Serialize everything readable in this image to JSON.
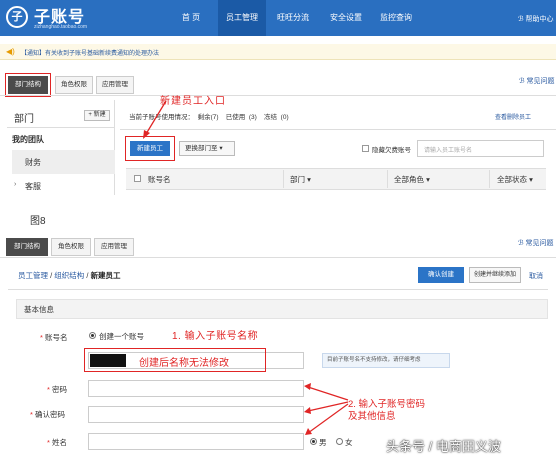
{
  "header": {
    "logo_glyph": "子",
    "title": "子账号",
    "subtitle": "zizhanghao.taobao.com",
    "nav": [
      "首 页",
      "员工管理",
      "旺旺分流",
      "安全设置",
      "监控查询"
    ],
    "right_link": "ℬ 帮助中心"
  },
  "notice": {
    "text": "【通知】有关收到子账号基础新续费通知的处理办法"
  },
  "tabs": [
    "部门结构",
    "角色权限",
    "应用管理"
  ],
  "help_link": "常见问题",
  "panel1": {
    "department_title": "部门",
    "new_button": "+ 新建",
    "team": "我的团队",
    "dept_items": [
      "财务",
      "客服"
    ],
    "usage_text": "当前子账号使用情况：  剩余(7)    已使用  (3)    冻结  (0)",
    "view_deleted": "查看删除员工",
    "new_employee_button": "新建员工",
    "change_dept_button": "更换部门至",
    "hide_expired": "隐藏欠费账号",
    "search_placeholder": "请输入员工账号名",
    "columns": [
      "账号名",
      "部门",
      "全部角色",
      "全部状态"
    ],
    "annotation": "新建员工入口"
  },
  "figure_label": "图8",
  "panel2": {
    "help_link": "常见问题",
    "breadcrumb": [
      "员工管理",
      "组织结构",
      "新建员工"
    ],
    "breadcrumb_sep": "/",
    "confirm_button": "确认创建",
    "create_continue_button": "创建并继续添加",
    "cancel_link": "取消",
    "section_title": "基本信息",
    "account_label": "账号名",
    "create_one": "创建一个账号",
    "name_note": "创建后名称无法修改",
    "name_hint": "目前子账号名不支持修改，请仔细考虑",
    "password_label": "密码",
    "confirm_password_label": "确认密码",
    "real_name_label": "姓名",
    "gender_male": "男",
    "gender_female": "女",
    "annotation_1": "1. 输入子账号名称",
    "annotation_2_line1": "2. 输入子账号密码",
    "annotation_2_line2": "及其他信息"
  },
  "watermark": "头条号 / 电商田义波"
}
